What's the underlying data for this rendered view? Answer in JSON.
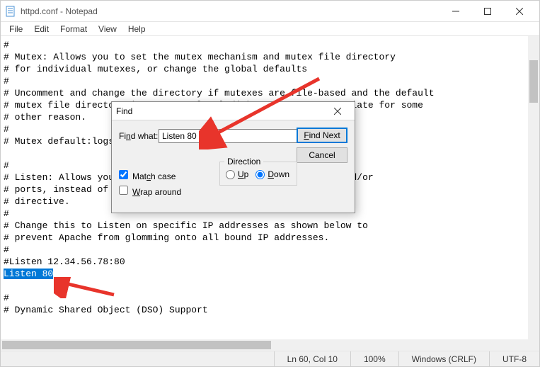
{
  "window": {
    "title": "httpd.conf - Notepad"
  },
  "menu": {
    "file": "File",
    "edit": "Edit",
    "format": "Format",
    "view": "View",
    "help": "Help"
  },
  "editor": {
    "lines": [
      "#",
      "# Mutex: Allows you to set the mutex mechanism and mutex file directory",
      "# for individual mutexes, or change the global defaults",
      "#",
      "# Uncomment and change the directory if mutexes are file-based and the default",
      "# mutex file directory is not on a local disk or is not appropriate for some",
      "# other reason.",
      "#",
      "# Mutex default:logs",
      "",
      "#",
      "# Listen: Allows you to bind Apache to specific IP addresses and/or",
      "# ports, instead of the default. See also the <VirtualHost>",
      "# directive.",
      "#",
      "# Change this to Listen on specific IP addresses as shown below to",
      "# prevent Apache from glomming onto all bound IP addresses.",
      "#",
      "#Listen 12.34.56.78:80",
      "Listen 80",
      "",
      "#",
      "# Dynamic Shared Object (DSO) Support"
    ],
    "highlight_line_index": 19,
    "highlight_text": "Listen 80"
  },
  "find": {
    "title": "Find",
    "label": "Find what:",
    "value": "Listen 80",
    "find_next": "Find Next",
    "cancel": "Cancel",
    "direction_label": "Direction",
    "up": "Up",
    "down": "Down",
    "direction_selected": "down",
    "match_case": "Match case",
    "match_case_checked": true,
    "wrap_around": "Wrap around",
    "wrap_around_checked": false
  },
  "status": {
    "position": "Ln 60, Col 10",
    "zoom": "100%",
    "line_ending": "Windows (CRLF)",
    "encoding": "UTF-8"
  }
}
